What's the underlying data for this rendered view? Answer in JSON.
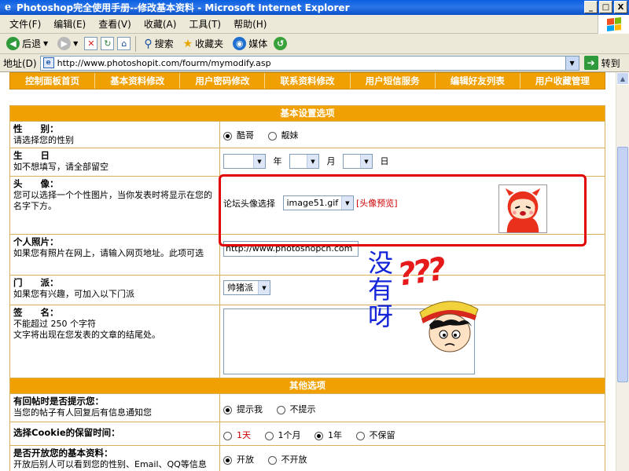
{
  "window": {
    "title": "Photoshop完全使用手册--修改基本资料 - Microsoft Internet Explorer",
    "buttons": [
      "_",
      "□",
      "X"
    ]
  },
  "menu": [
    "文件(F)",
    "编辑(E)",
    "查看(V)",
    "收藏(A)",
    "工具(T)",
    "帮助(H)"
  ],
  "toolbar": {
    "back": "后退",
    "search": "搜索",
    "favorites": "收藏夹",
    "media": "媒体"
  },
  "address": {
    "label": "地址(D)",
    "url": "http://www.photoshopit.com/fourm/mymodify.asp",
    "go": "转到"
  },
  "nav_tabs": [
    "控制面板首页",
    "基本资料修改",
    "用户密码修改",
    "联系资料修改",
    "用户短信服务",
    "编辑好友列表",
    "用户收藏管理"
  ],
  "basic": {
    "header": "基本设置选项",
    "gender": {
      "title": "性　　别：",
      "desc": "请选择您的性别",
      "options": [
        "酷哥",
        "靓妹"
      ],
      "selected": 0
    },
    "birthday": {
      "title": "生　　日",
      "desc": "如不想填写，请全部留空",
      "year": "年",
      "month": "月",
      "day": "日"
    },
    "avatar": {
      "title": "头　　像：",
      "desc": "您可以选择一个个性图片，当你发表时将显示在您的名字下方。",
      "select_label": "论坛头像选择",
      "select_value": "image51.gif",
      "preview_link": "[头像预览]"
    },
    "photo": {
      "title": "个人照片：",
      "desc": "如果您有照片在网上，请输入网页地址。此项可选",
      "value": "http://www.photoshopcn.com"
    },
    "faction": {
      "title": "门　　派：",
      "desc": "如果您有兴趣，可加入以下门派",
      "value": "帅猪派"
    },
    "signature": {
      "title": "签　　名：",
      "desc1": "不能超过 250 个字符",
      "desc2": "文字将出现在您发表的文章的结尾处。"
    }
  },
  "other": {
    "header": "其他选项",
    "reply": {
      "title": "有回帖时是否提示您：",
      "desc": "当您的帖子有人回复后有信息通知您",
      "options": [
        "提示我",
        "不提示"
      ],
      "selected": 0
    },
    "cookie": {
      "title": "选择Cookie的保留时间：",
      "options": [
        "1天",
        "1个月",
        "1年",
        "不保留"
      ],
      "selected": 2
    },
    "open": {
      "title": "是否开放您的基本资料：",
      "desc": "开放后别人可以看到您的性别、Email、QQ等信息",
      "options": [
        "开放",
        "不开放"
      ],
      "selected": 0
    }
  },
  "overlay": {
    "text": "没有呀",
    "marks": "???"
  },
  "colors": {
    "accent": "#f0a000",
    "highlight": "#e00000",
    "overlay_text": "#1424d8"
  }
}
